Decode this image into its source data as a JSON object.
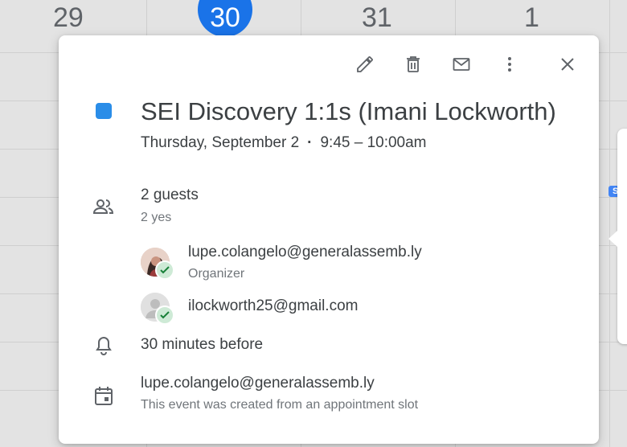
{
  "calendar": {
    "day_numbers": [
      "29",
      "30",
      "31",
      "1"
    ],
    "side_chip_text": "S"
  },
  "toolbar": {
    "edit": "edit-icon",
    "delete": "delete-icon",
    "email": "email-icon",
    "more": "more-options-icon",
    "close": "close-icon"
  },
  "event": {
    "color": "#2a8de8",
    "title": "SEI Discovery 1:1s (Imani Lockworth)",
    "date": "Thursday, September 2",
    "time": "9:45 – 10:00am"
  },
  "guests": {
    "summary": "2 guests",
    "responses": "2 yes",
    "list": [
      {
        "email": "lupe.colangelo@generalassemb.ly",
        "role": "Organizer"
      },
      {
        "email": "ilockworth25@gmail.com",
        "role": ""
      }
    ]
  },
  "reminder": {
    "text": "30 minutes before"
  },
  "calendar_info": {
    "owner": "lupe.colangelo@generalassemb.ly",
    "note": "This event was created from an appointment slot"
  }
}
